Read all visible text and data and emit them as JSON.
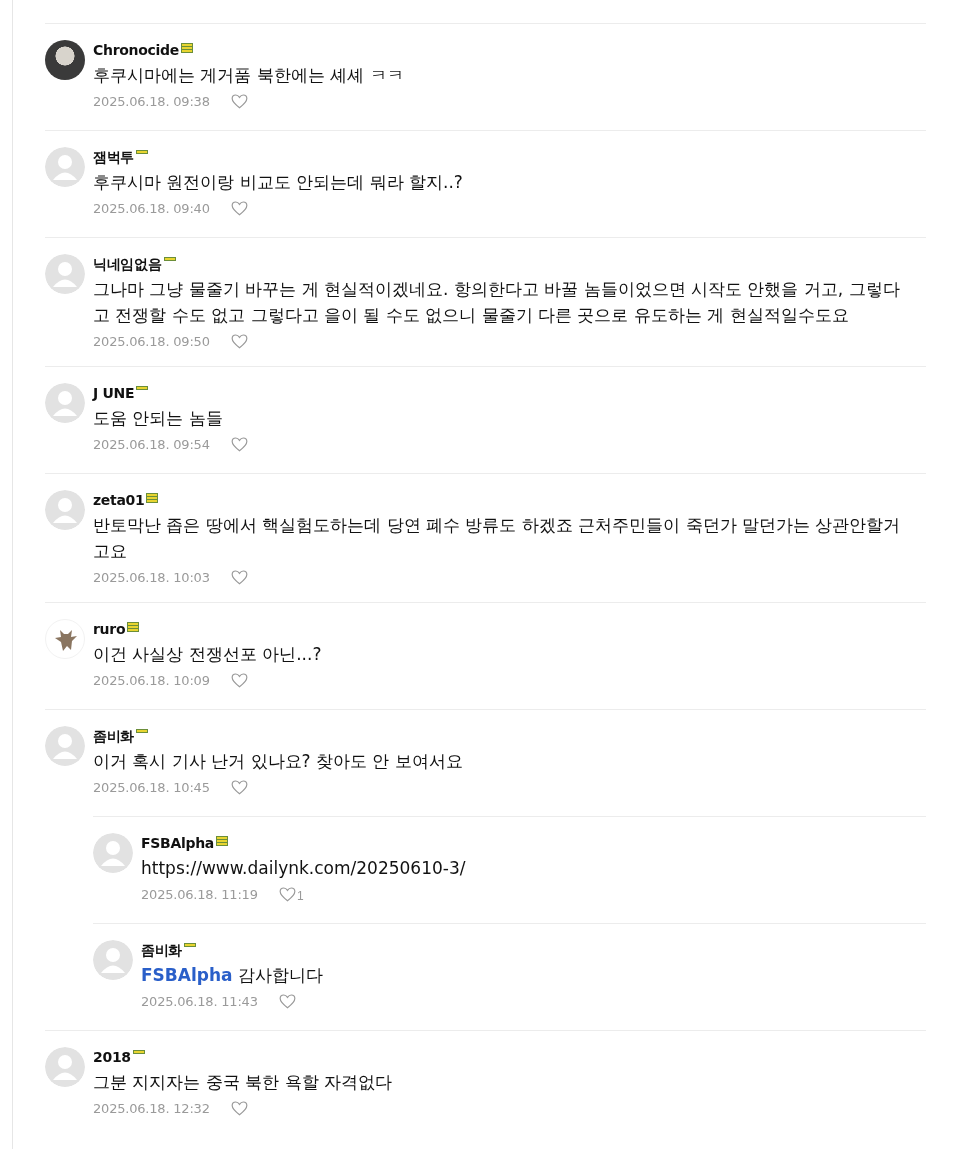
{
  "comments": [
    {
      "author": "Chronocide",
      "badge": {
        "kind": "triple"
      },
      "avatar": {
        "kind": "photo"
      },
      "text": "후쿠시마에는 게거품 북한에는 셰셰 ㅋㅋ",
      "date": "2025.06.18. 09:38"
    },
    {
      "author": "잼벅투",
      "badge": {
        "kind": "single"
      },
      "avatar": {
        "kind": "default"
      },
      "text": "후쿠시마 원전이랑 비교도 안되는데 뭐라 할지..?",
      "date": "2025.06.18. 09:40"
    },
    {
      "author": "닉네임없음",
      "badge": {
        "kind": "single"
      },
      "avatar": {
        "kind": "default"
      },
      "text": "그나마 그냥 물줄기 바꾸는 게 현실적이겠네요. 항의한다고 바꿀 놈들이었으면 시작도 안했을 거고, 그렇다고 전쟁할 수도 없고 그렇다고 을이 될 수도 없으니 물줄기 다른 곳으로 유도하는 게 현실적일수도요",
      "date": "2025.06.18. 09:50"
    },
    {
      "author": "J UNE",
      "badge": {
        "kind": "single"
      },
      "avatar": {
        "kind": "default"
      },
      "text": "도움 안되는 놈들",
      "date": "2025.06.18. 09:54"
    },
    {
      "author": "zeta01",
      "badge": {
        "kind": "triple"
      },
      "avatar": {
        "kind": "default"
      },
      "text": "반토막난 좁은 땅에서 핵실험도하는데 당연 폐수 방류도 하겠죠 근처주민들이 죽던가 말던가는 상관안할거고요",
      "date": "2025.06.18. 10:03"
    },
    {
      "author": "ruro",
      "badge": {
        "kind": "triple"
      },
      "avatar": {
        "kind": "image"
      },
      "text": "이건 사실상 전쟁선포 아닌...?",
      "date": "2025.06.18. 10:09"
    },
    {
      "author": "좀비화",
      "badge": {
        "kind": "single"
      },
      "avatar": {
        "kind": "default"
      },
      "text": "이거 혹시 기사 난거 있나요? 찾아도 안 보여서요",
      "date": "2025.06.18. 10:45",
      "replies": [
        {
          "author": "FSBAlpha",
          "badge": {
            "kind": "triple"
          },
          "avatar": {
            "kind": "default"
          },
          "text": "https://www.dailynk.com/20250610-3/",
          "date": "2025.06.18. 11:19",
          "likes": "1"
        },
        {
          "author": "좀비화",
          "badge": {
            "kind": "single"
          },
          "avatar": {
            "kind": "default"
          },
          "mention": "FSBAlpha",
          "text": "감사합니다",
          "date": "2025.06.18. 11:43"
        }
      ]
    },
    {
      "author": "2018",
      "badge": {
        "kind": "single"
      },
      "avatar": {
        "kind": "default"
      },
      "text": "그분 지지자는 중국 북한 욕할 자격없다",
      "date": "2025.06.18. 12:32"
    }
  ]
}
